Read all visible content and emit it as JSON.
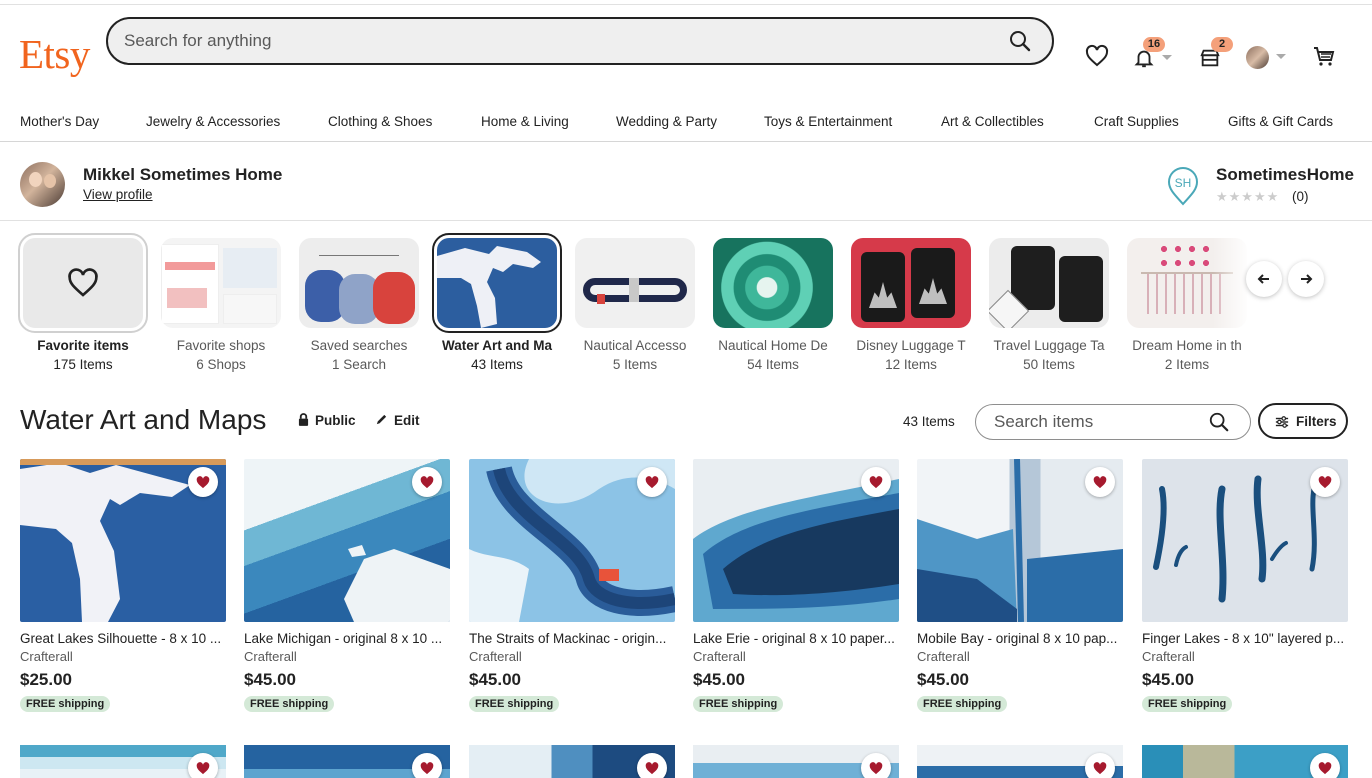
{
  "brand": "Etsy",
  "search": {
    "placeholder": "Search for anything"
  },
  "header": {
    "notifications_count": "16",
    "shop_count": "2"
  },
  "categories": [
    "Mother's Day",
    "Jewelry & Accessories",
    "Clothing & Shoes",
    "Home & Living",
    "Wedding & Party",
    "Toys & Entertainment",
    "Art & Collectibles",
    "Craft Supplies",
    "Gifts & Gift Cards"
  ],
  "profile": {
    "name": "Mikkel Sometimes Home",
    "link": "View profile"
  },
  "shop": {
    "logo_text": "SH",
    "name": "SometimesHome",
    "rating_count": "(0)"
  },
  "collections": [
    {
      "name": "Favorite items",
      "count": "175 Items"
    },
    {
      "name": "Favorite shops",
      "count": "6 Shops"
    },
    {
      "name": "Saved searches",
      "count": "1 Search"
    },
    {
      "name": "Water Art and Ma",
      "count": "43 Items"
    },
    {
      "name": "Nautical Accesso",
      "count": "5 Items"
    },
    {
      "name": "Nautical Home De",
      "count": "54 Items"
    },
    {
      "name": "Disney Luggage T",
      "count": "12 Items"
    },
    {
      "name": "Travel Luggage Ta",
      "count": "50 Items"
    },
    {
      "name": "Dream Home in th",
      "count": "2 Items"
    }
  ],
  "collection": {
    "title": "Water Art and Maps",
    "visibility": "Public",
    "edit": "Edit",
    "item_count": "43 Items",
    "search_placeholder": "Search items",
    "filters": "Filters"
  },
  "products": [
    {
      "title": "Great Lakes Silhouette - 8 x 10 ...",
      "shop": "Crafterall",
      "price": "$25.00",
      "shipping": "FREE shipping"
    },
    {
      "title": "Lake Michigan - original 8 x 10 ...",
      "shop": "Crafterall",
      "price": "$45.00",
      "shipping": "FREE shipping"
    },
    {
      "title": "The Straits of Mackinac - origin...",
      "shop": "Crafterall",
      "price": "$45.00",
      "shipping": "FREE shipping"
    },
    {
      "title": "Lake Erie - original 8 x 10 paper...",
      "shop": "Crafterall",
      "price": "$45.00",
      "shipping": "FREE shipping"
    },
    {
      "title": "Mobile Bay - original 8 x 10 pap...",
      "shop": "Crafterall",
      "price": "$45.00",
      "shipping": "FREE shipping"
    },
    {
      "title": "Finger Lakes - 8 x 10\" layered p...",
      "shop": "Crafterall",
      "price": "$45.00",
      "shipping": "FREE shipping"
    }
  ],
  "colors": {
    "brand": "#f1641e",
    "heart": "#a61a2e",
    "shipping_bg": "#d4e9d7",
    "badge": "#f4a07a"
  },
  "icons": [
    "search-icon",
    "heart-icon",
    "bell-icon",
    "shop-icon",
    "cart-icon",
    "lock-icon",
    "pencil-icon",
    "filter-icon",
    "arrow-left-icon",
    "arrow-right-icon"
  ]
}
